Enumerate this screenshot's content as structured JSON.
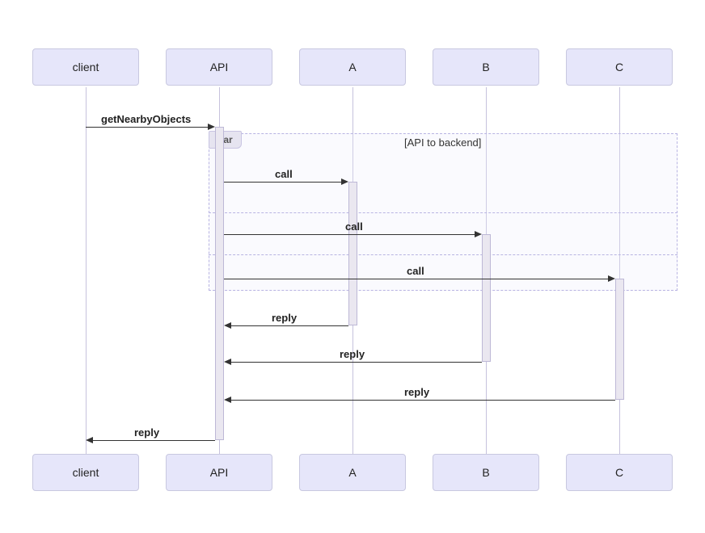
{
  "participants": {
    "p0": "client",
    "p1": "API",
    "p2": "A",
    "p3": "B",
    "p4": "C"
  },
  "messages": {
    "m1": "getNearbyObjects",
    "m2": "call",
    "m3": "call",
    "m4": "call",
    "m5": "reply",
    "m6": "reply",
    "m7": "reply",
    "m8": "reply"
  },
  "fragment": {
    "operator": "par",
    "title": "[API to backend]"
  },
  "chart_data": {
    "type": "sequence-diagram",
    "participants": [
      "client",
      "API",
      "A",
      "B",
      "C"
    ],
    "parallel_fragment": {
      "operator": "par",
      "label": "API to backend",
      "source": "API",
      "threads": [
        {
          "to": "A",
          "message": "call"
        },
        {
          "to": "B",
          "message": "call"
        },
        {
          "to": "C",
          "message": "call"
        }
      ]
    },
    "events": [
      {
        "from": "client",
        "to": "API",
        "label": "getNearbyObjects",
        "direction": "request"
      },
      {
        "from": "API",
        "to": "A",
        "label": "call",
        "direction": "request",
        "parallel": true
      },
      {
        "from": "API",
        "to": "B",
        "label": "call",
        "direction": "request",
        "parallel": true
      },
      {
        "from": "API",
        "to": "C",
        "label": "call",
        "direction": "request",
        "parallel": true
      },
      {
        "from": "A",
        "to": "API",
        "label": "reply",
        "direction": "reply"
      },
      {
        "from": "B",
        "to": "API",
        "label": "reply",
        "direction": "reply"
      },
      {
        "from": "C",
        "to": "API",
        "label": "reply",
        "direction": "reply"
      },
      {
        "from": "API",
        "to": "client",
        "label": "reply",
        "direction": "reply"
      }
    ]
  }
}
